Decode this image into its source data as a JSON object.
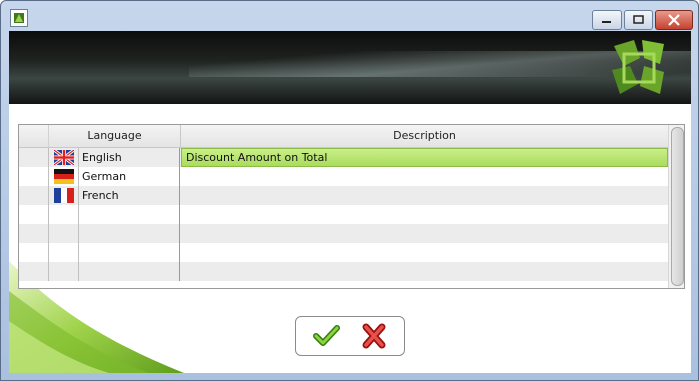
{
  "window": {
    "title": "",
    "controls": [
      "minimize",
      "maximize",
      "close"
    ]
  },
  "grid": {
    "headers": {
      "language": "Language",
      "description": "Description"
    },
    "rows": [
      {
        "flag": "uk-flag",
        "language": "English",
        "description": "Discount Amount on Total",
        "active": true
      },
      {
        "flag": "german-flag",
        "language": "German",
        "description": "",
        "active": false
      },
      {
        "flag": "french-flag",
        "language": "French",
        "description": "",
        "active": false
      },
      {
        "flag": "",
        "language": "",
        "description": "",
        "active": false
      },
      {
        "flag": "",
        "language": "",
        "description": "",
        "active": false
      },
      {
        "flag": "",
        "language": "",
        "description": "",
        "active": false
      },
      {
        "flag": "",
        "language": "",
        "description": "",
        "active": false
      }
    ]
  },
  "actions": {
    "ok_icon": "green-check-icon",
    "cancel_icon": "red-x-icon"
  },
  "colors": {
    "active_row": "#b9e673",
    "accent_green": "#7cbf1f"
  }
}
